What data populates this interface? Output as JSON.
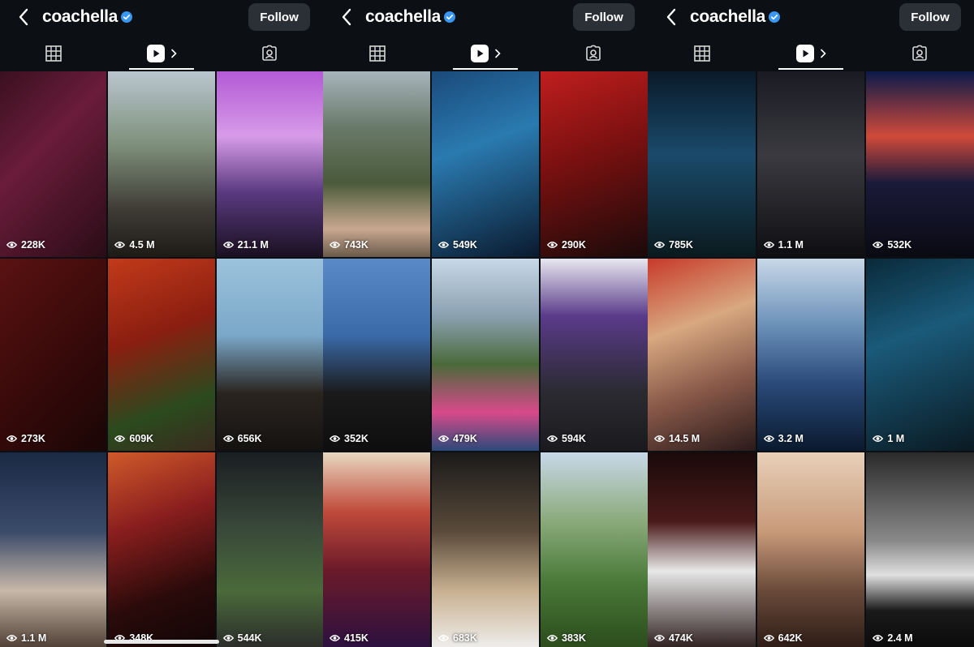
{
  "profile": {
    "username": "coachella",
    "follow_label": "Follow"
  },
  "icons": {
    "back": "chevron-left-icon",
    "verified": "verified-badge-icon",
    "grid": "grid-icon",
    "reels": "reels-icon",
    "tagged": "tagged-icon",
    "views": "eye-icon"
  },
  "colors": {
    "background": "#0c0f14",
    "verified": "#3897f0",
    "follow_button": "#2b2f36"
  },
  "active_tab": "reels",
  "screens": [
    {
      "tiles": [
        {
          "views": "228K",
          "bg": "linear-gradient(135deg,#3a1020 0%,#6a1c3a 40%,#2a0c16 100%)"
        },
        {
          "views": "4.5 M",
          "bg": "linear-gradient(180deg,#b9c6cf 0%,#7d8f7a 40%,#3e3a34 75%,#1e1a16 100%)"
        },
        {
          "views": "21.1 M",
          "bg": "linear-gradient(180deg,#b45ad6 0%,#d79be8 35%,#5a3a80 65%,#1a1020 100%)"
        },
        {
          "views": "273K",
          "bg": "linear-gradient(135deg,#5a1212 0%,#3a0a0a 50%,#1a0606 100%)"
        },
        {
          "views": "609K",
          "bg": "linear-gradient(160deg,#c23a1a 0%,#8a1e10 40%,#2b4a1e 75%,#3a2a1e 100%)"
        },
        {
          "views": "656K",
          "bg": "linear-gradient(180deg,#9cc2dc 0%,#7aa8c8 40%,#2a2420 70%,#141210 100%)"
        },
        {
          "views": "1.1 M",
          "bg": "linear-gradient(180deg,#1a2a44 0%,#3a4a6a 40%,#c8b8a8 70%,#4a3a30 100%)"
        },
        {
          "views": "348K",
          "bg": "linear-gradient(160deg,#d05a2a 0%,#8a1e1e 35%,#2a0a0a 70%,#100606 100%)"
        },
        {
          "views": "544K",
          "bg": "linear-gradient(180deg,#1a1e22 0%,#3a4a3a 40%,#4a6a3a 70%,#2a2a2a 100%)"
        }
      ]
    },
    {
      "tiles": [
        {
          "views": "743K",
          "bg": "linear-gradient(180deg,#a8b4bc 0%,#6a7a6a 30%,#4a5a3a 60%,#c9a890 85%,#6a5a4a 100%)"
        },
        {
          "views": "549K",
          "bg": "linear-gradient(160deg,#1a4a7a 0%,#2a7ab0 40%,#0a1a2e 100%)"
        },
        {
          "views": "290K",
          "bg": "linear-gradient(160deg,#c01e1e 0%,#7a1010 45%,#1a0a0a 100%)"
        },
        {
          "views": "352K",
          "bg": "linear-gradient(180deg,#5a8ac8 0%,#3a6aa8 40%,#1a1a1a 70%,#0e0e0e 100%)"
        },
        {
          "views": "479K",
          "bg": "linear-gradient(180deg,#c8d8e8 0%,#8aa0b0 30%,#4a6a3a 55%,#d84a8a 80%,#2a4a7a 100%)"
        },
        {
          "views": "594K",
          "bg": "linear-gradient(180deg,#e8e8f0 0%,#5a3a8a 30%,#2a2a30 70%,#1a1a1e 100%)"
        },
        {
          "views": "415K",
          "bg": "linear-gradient(180deg,#e8d8c0 0%,#c04a3a 30%,#6a1a2a 60%,#2a1040 100%)"
        },
        {
          "views": "683K",
          "bg": "linear-gradient(180deg,#1a1a1a 0%,#5a4a3a 40%,#c8b090 70%,#f0f0f0 100%)"
        },
        {
          "views": "383K",
          "bg": "linear-gradient(180deg,#c8d8e8 0%,#8aaa7a 35%,#4a7a3a 65%,#2a4a1a 100%)"
        }
      ]
    },
    {
      "tiles": [
        {
          "views": "785K",
          "bg": "linear-gradient(180deg,#0a1a2a 0%,#1a4a6a 45%,#0a1a1e 100%)"
        },
        {
          "views": "1.1 M",
          "bg": "linear-gradient(180deg,#1a1a22 0%,#3a3a40 45%,#0e0e12 100%)"
        },
        {
          "views": "532K",
          "bg": "linear-gradient(180deg,#0a1a4a 0%,#d04a3a 35%,#1a1a3a 60%,#0a0a12 100%)"
        },
        {
          "views": "14.5 M",
          "bg": "linear-gradient(160deg,#c83a2a 0%,#d8a880 35%,#8a5a4a 65%,#2a1a1a 100%)"
        },
        {
          "views": "3.2 M",
          "bg": "linear-gradient(180deg,#c8d8e8 0%,#6a90b8 35%,#2a4a7a 65%,#0a1a2e 100%)"
        },
        {
          "views": "1 M",
          "bg": "linear-gradient(160deg,#0a2a3a 0%,#1a5a7a 40%,#0a1a22 100%)"
        },
        {
          "views": "474K",
          "bg": "linear-gradient(180deg,#1a0a0a 0%,#4a1a1a 35%,#e8e8e8 60%,#2a1a1a 100%)"
        },
        {
          "views": "642K",
          "bg": "linear-gradient(180deg,#e8d0b8 0%,#c89a7a 40%,#6a4a3a 70%,#2a1a14 100%)"
        },
        {
          "views": "2.4 M",
          "bg": "linear-gradient(180deg,#2a2a2a 0%,#8a8a8a 45%,#e0e0e0 62%,#1a1a1a 80%,#0a0a0a 100%)"
        }
      ]
    }
  ]
}
